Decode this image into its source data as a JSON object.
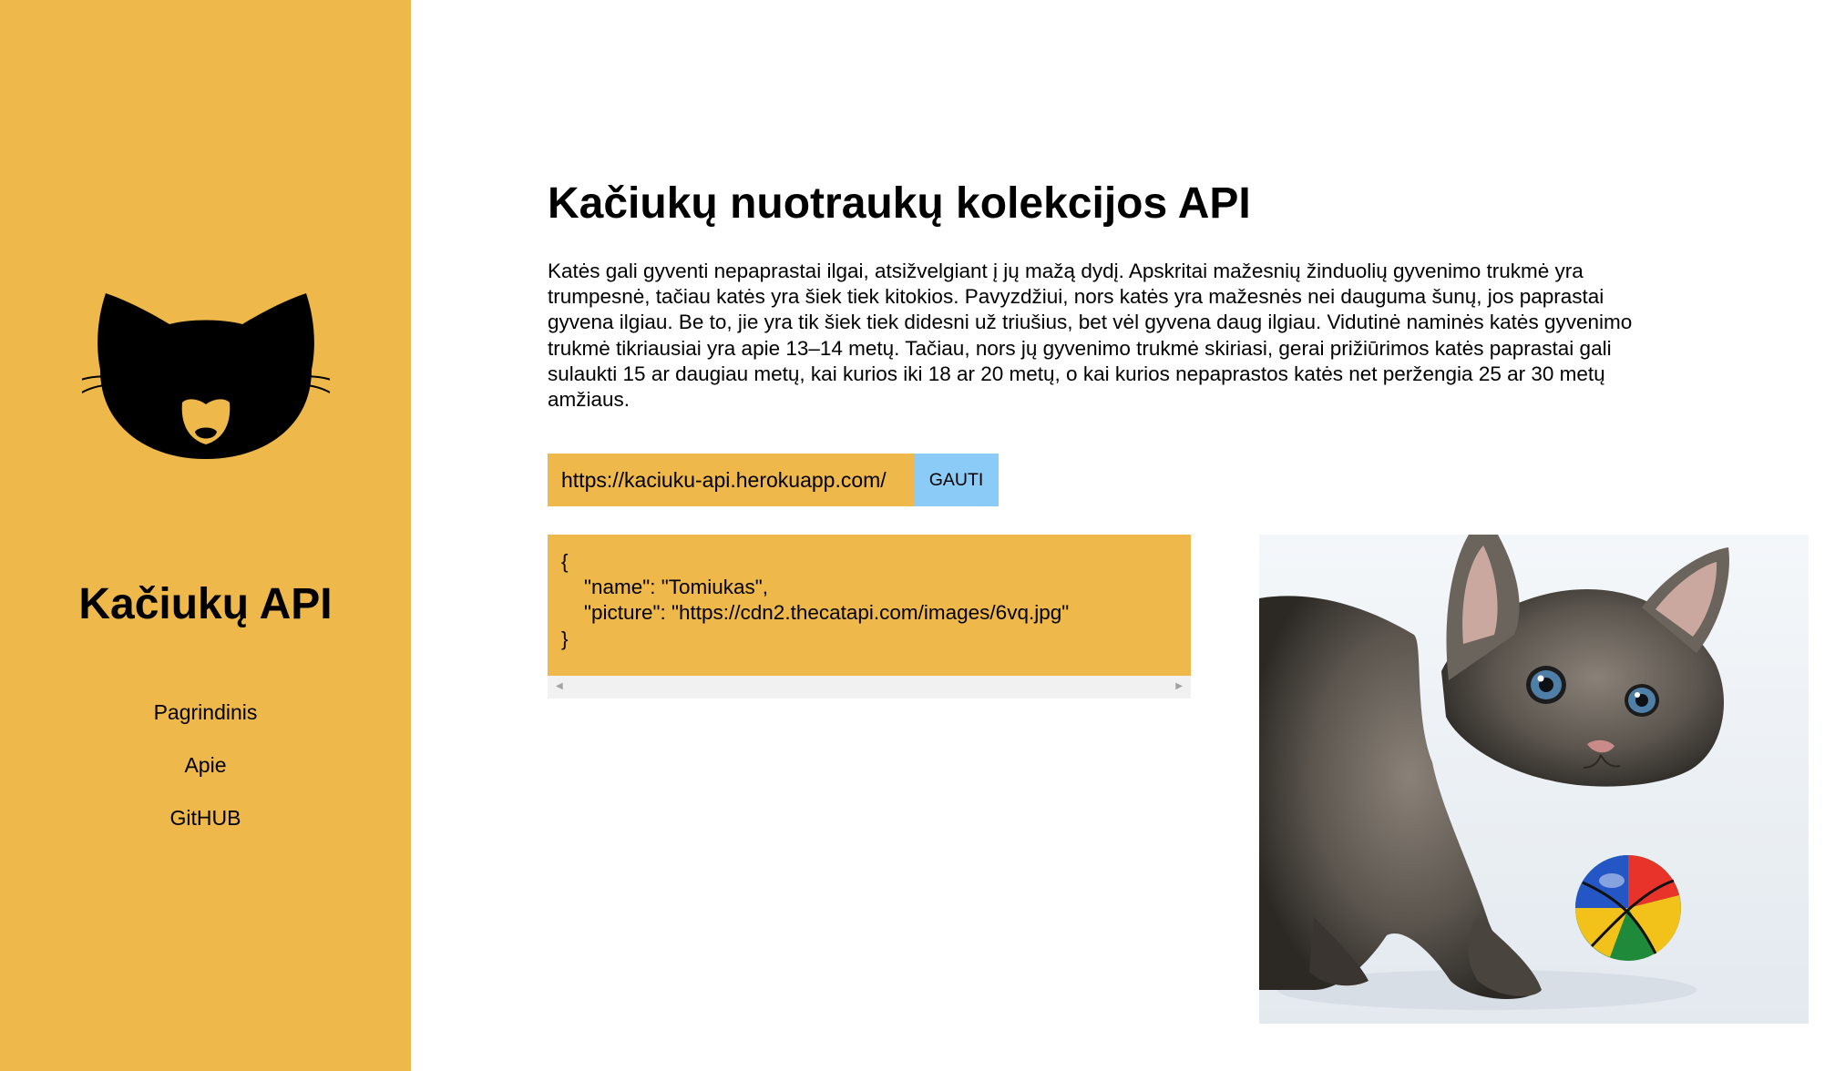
{
  "sidebar": {
    "logo_icon": "cat-head-icon",
    "brand": "Kačiukų API",
    "nav": [
      {
        "label": "Pagrindinis"
      },
      {
        "label": "Apie"
      },
      {
        "label": "GitHUB"
      }
    ]
  },
  "main": {
    "title": "Kačiukų nuotraukų kolekcijos API",
    "intro": "Katės gali gyventi nepaprastai ilgai, atsižvelgiant į jų mažą dydį. Apskritai mažesnių žinduolių gyvenimo trukmė yra trumpesnė, tačiau katės yra šiek tiek kitokios. Pavyzdžiui, nors katės yra mažesnės nei dauguma šunų, jos paprastai gyvena ilgiau. Be to, jie yra tik šiek tiek didesni už triušius, bet vėl gyvena daug ilgiau. Vidutinė naminės katės gyvenimo trukmė tikriausiai yra apie 13–14 metų. Tačiau, nors jų gyvenimo trukmė skiriasi, gerai prižiūrimos katės paprastai gali sulaukti 15 ar daugiau metų, kai kurios iki 18 ar 20 metų, o kai kurios nepaprastos katės net peržengia 25 ar 30 metų amžiaus.",
    "url": "https://kaciuku-api.herokuapp.com/",
    "get_button": "GAUTI",
    "response": "{\n    \"name\": \"Tomiukas\",\n    \"picture\": \"https://cdn2.thecatapi.com/images/6vq.jpg\"\n}",
    "photo_subject": "kitten-with-ball-photo"
  },
  "colors": {
    "accent": "#efb84b",
    "button": "#8bcbf7",
    "background": "#ffffff"
  }
}
